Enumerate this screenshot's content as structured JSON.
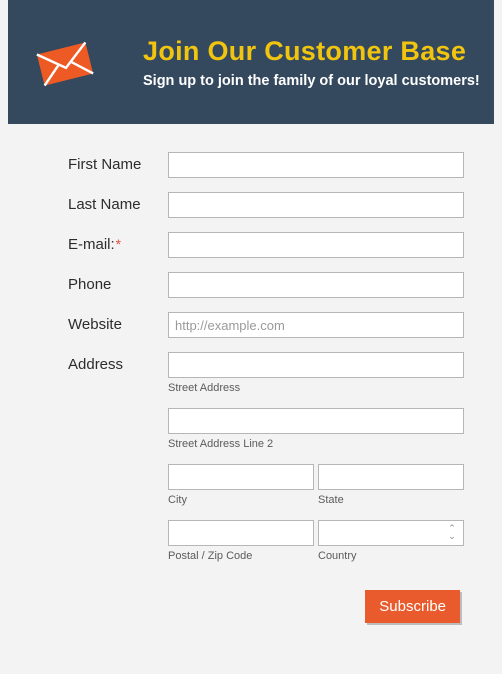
{
  "header": {
    "title": "Join Our Customer Base",
    "subtitle": "Sign up to join the family of our loyal customers!"
  },
  "form": {
    "first_name": {
      "label": "First Name",
      "value": ""
    },
    "last_name": {
      "label": "Last Name",
      "value": ""
    },
    "email": {
      "label": "E-mail:",
      "value": "",
      "required_mark": "*"
    },
    "phone": {
      "label": "Phone",
      "value": ""
    },
    "website": {
      "label": "Website",
      "value": "",
      "placeholder": "http://example.com"
    },
    "address": {
      "label": "Address",
      "street1": {
        "value": "",
        "sublabel": "Street Address"
      },
      "street2": {
        "value": "",
        "sublabel": "Street Address Line 2"
      },
      "city": {
        "value": "",
        "sublabel": "City"
      },
      "state": {
        "value": "",
        "sublabel": "State"
      },
      "postal": {
        "value": "",
        "sublabel": "Postal / Zip Code"
      },
      "country": {
        "value": "",
        "sublabel": "Country"
      }
    },
    "submit_label": "Subscribe"
  },
  "colors": {
    "header_bg": "#34495e",
    "title": "#f1c40f",
    "accent": "#e95b2c",
    "envelope": "#ee5a24"
  }
}
